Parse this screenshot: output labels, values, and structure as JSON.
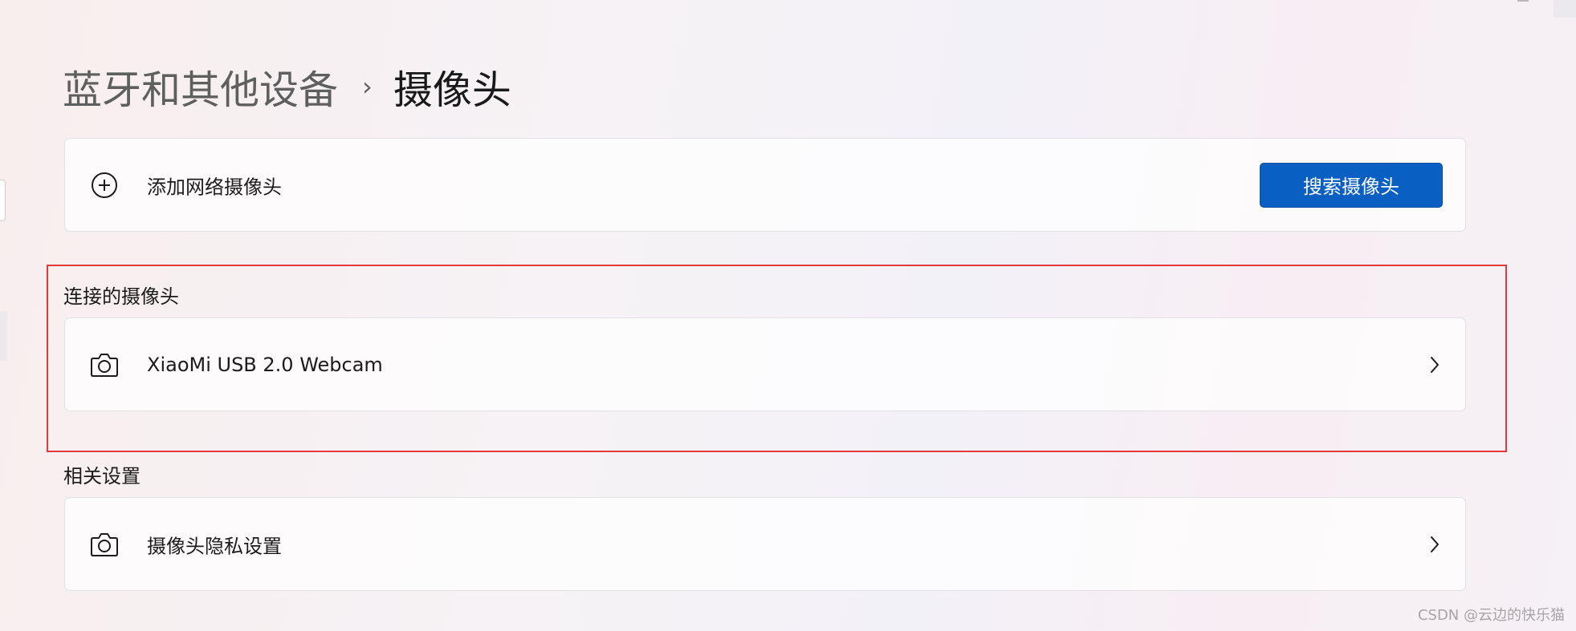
{
  "breadcrumb": {
    "parent": "蓝牙和其他设备",
    "separator": "›",
    "current": "摄像头"
  },
  "add_network_camera": {
    "icon": "plus-circle-icon",
    "label": "添加网络摄像头",
    "button_label": "搜索摄像头"
  },
  "connected_cameras": {
    "heading": "连接的摄像头",
    "items": [
      {
        "icon": "camera-icon",
        "label": "XiaoMi USB 2.0 Webcam"
      }
    ]
  },
  "related_settings": {
    "heading": "相关设置",
    "items": [
      {
        "icon": "camera-icon",
        "label": "摄像头隐私设置"
      }
    ]
  },
  "watermark": "CSDN @云边的快乐猫",
  "colors": {
    "accent": "#0a5fc2",
    "highlight": "#e23a3a"
  }
}
